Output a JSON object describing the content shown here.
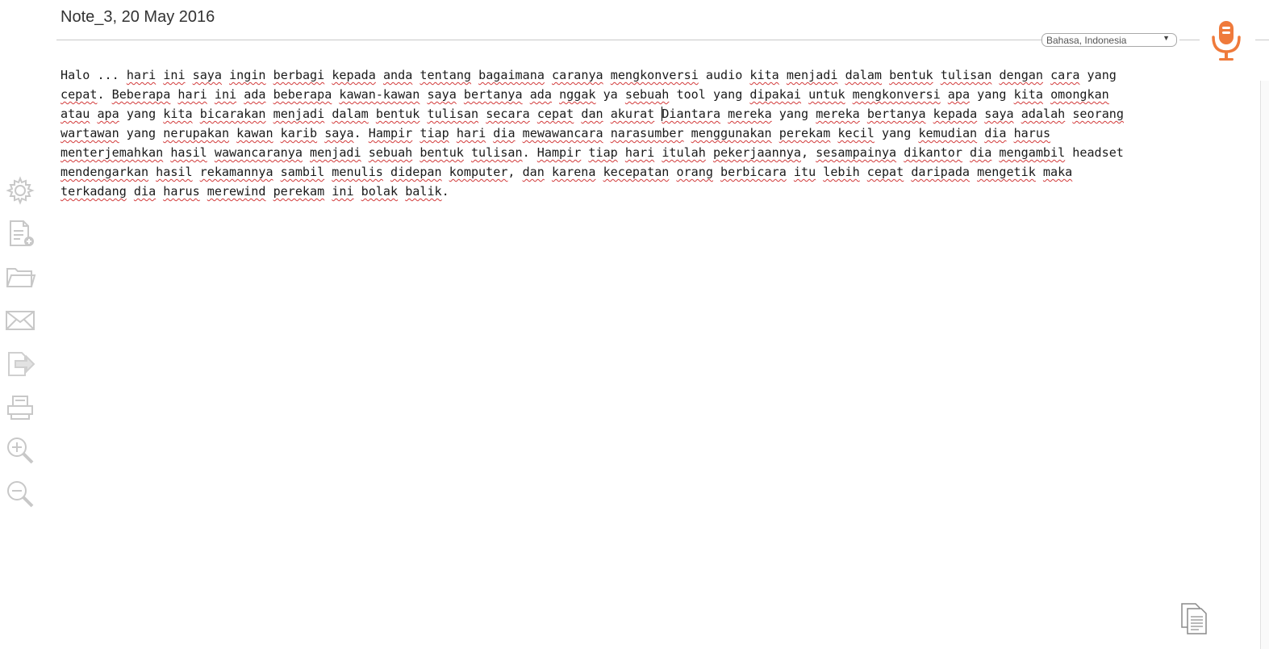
{
  "note": {
    "title": "Note_3, 20 May 2016"
  },
  "language": {
    "selected": "Bahasa, Indonesia",
    "caret": "▼"
  },
  "colors": {
    "accent": "#ef7a3b",
    "icon_gray": "#c4c4c4",
    "spellcheck": "#d23a3a"
  },
  "sidebar": {
    "items": [
      {
        "icon": "gear-icon",
        "label": "settings"
      },
      {
        "icon": "new-document-icon",
        "label": "new note"
      },
      {
        "icon": "folder-icon",
        "label": "open"
      },
      {
        "icon": "mail-icon",
        "label": "email"
      },
      {
        "icon": "export-icon",
        "label": "export"
      },
      {
        "icon": "printer-icon",
        "label": "print"
      },
      {
        "icon": "zoom-in-icon",
        "label": "zoom in"
      },
      {
        "icon": "zoom-out-icon",
        "label": "zoom out"
      }
    ]
  },
  "editor": {
    "text": "Halo ... hari ini saya ingin berbagi kepada anda tentang bagaimana caranya mengkonversi audio kita menjadi dalam bentuk tulisan dengan cara yang cepat. Beberapa hari ini ada beberapa kawan-kawan saya bertanya ada nggak ya sebuah tool yang dipakai untuk mengkonversi apa yang kita omongkan atau apa yang kita bicarakan menjadi dalam bentuk tulisan secara cepat dan akurat Diantara mereka yang mereka bertanya kepada saya adalah seorang wartawan yang nerupakan kawan karib saya. Hampir tiap hari dia mewawancara narasumber menggunakan perekam kecil yang kemudian dia harus menterjemahkan hasil wawancaranya menjadi sebuah bentuk tulisan. Hampir tiap hari itulah pekerjaannya, sesampainya dikantor dia mengambil headset mendengarkan hasil rekamannya sambil menulis didepan komputer, dan karena kecepatan orang berbicara itu lebih cepat daripada mengetik maka terkadang dia harus merewind perekam ini bolak balik.",
    "lines": [
      "Halo ... hari ini saya ingin berbagi kepada anda tentang bagaimana caranya mengkonversi audio kita menjadi dalam bentuk tulisan dengan cara yang",
      "cepat. Beberapa hari ini ada beberapa kawan-kawan saya bertanya ada nggak ya sebuah tool yang dipakai untuk mengkonversi apa yang kita omongkan",
      "atau apa yang kita bicarakan menjadi dalam bentuk tulisan secara cepat dan akurat Diantara mereka yang mereka bertanya kepada saya adalah seorang",
      "wartawan yang nerupakan kawan karib saya. Hampir tiap hari dia mewawancara narasumber menggunakan perekam kecil yang kemudian dia harus",
      "menterjemahkan hasil wawancaranya menjadi sebuah bentuk tulisan. Hampir tiap hari itulah pekerjaannya, sesampainya dikantor dia mengambil headset",
      "mendengarkan hasil rekamannya sambil menulis didepan komputer, dan karena kecepatan orang berbicara itu lebih cepat daripada mengetik maka",
      "terkadang dia harus merewind perekam ini bolak balik."
    ],
    "correct_words": [
      "Halo",
      "...",
      "audio",
      "yang",
      "ya",
      "tool",
      "headset"
    ],
    "caret_before": "Diantara"
  },
  "buttons": {
    "mic": "microphone-icon",
    "copy": "copy-icon"
  }
}
